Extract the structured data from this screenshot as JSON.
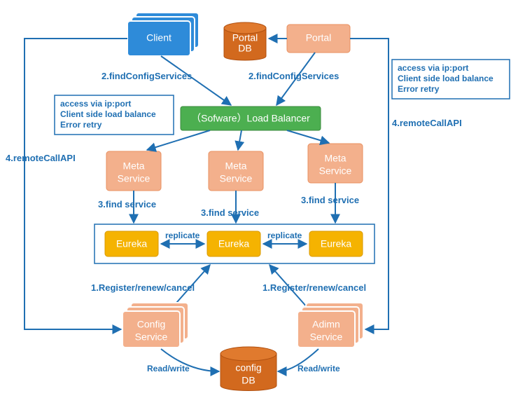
{
  "nodes": {
    "client": "Client",
    "portal": "Portal",
    "portal_db1": "Portal",
    "portal_db2": "DB",
    "load_balancer": "（Sofware）Load Balancer",
    "meta1a": "Meta",
    "meta1b": "Service",
    "meta2a": "Meta",
    "meta2b": "Service",
    "meta3a": "Meta",
    "meta3b": "Service",
    "eureka1": "Eureka",
    "eureka2": "Eureka",
    "eureka3": "Eureka",
    "config1": "Config",
    "config2": "Service",
    "admin1": "Adimn",
    "admin2": "Service",
    "cfgdb1": "config",
    "cfgdb2": "DB"
  },
  "edges": {
    "find_cfg_left": "2.findConfigServices",
    "find_cfg_right": "2.findConfigServices",
    "remote_left": "4.remoteCallAPI",
    "remote_right": "4.remoteCallAPI",
    "find_svc1": "3.find service",
    "find_svc2": "3.find service",
    "find_svc3": "3.find service",
    "replicate1": "replicate",
    "replicate2": "replicate",
    "register_left": "1.Register/renew/cancel",
    "register_right": "1.Register/renew/cancel",
    "rw_left": "Read/write",
    "rw_right": "Read/write"
  },
  "notes": {
    "l1": "access via ip:port",
    "l2": "Client side load balance",
    "l3": "Error retry",
    "r1": "access via ip:port",
    "r2": "Client side load balance",
    "r3": "Error retry"
  }
}
